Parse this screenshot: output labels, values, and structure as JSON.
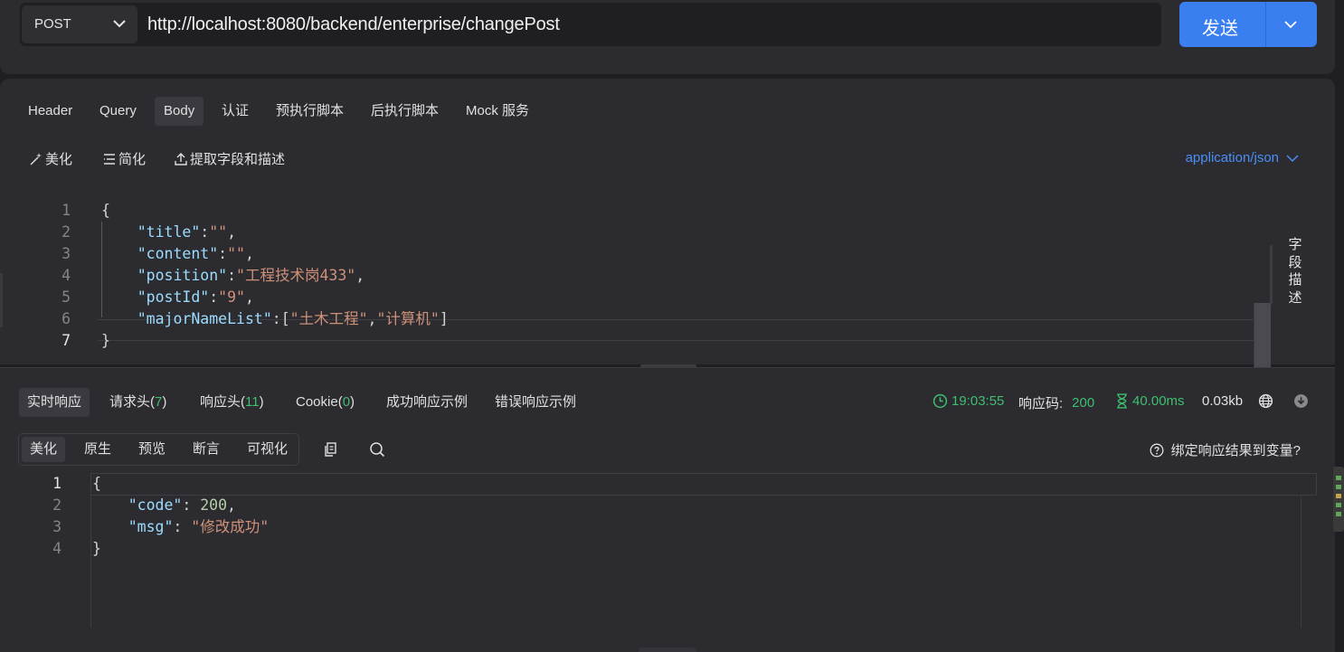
{
  "request": {
    "method": "POST",
    "url": "http://localhost:8080/backend/enterprise/changePost",
    "send_label": "发送"
  },
  "request_tabs": [
    "Header",
    "Query",
    "Body",
    "认证",
    "预执行脚本",
    "后执行脚本",
    "Mock 服务"
  ],
  "active_request_tab": "Body",
  "body_tools": {
    "beautify": "美化",
    "simplify": "简化",
    "extract": "提取字段和描述",
    "content_type": "application/json"
  },
  "request_body": {
    "line_numbers": [
      "1",
      "2",
      "3",
      "4",
      "5",
      "6",
      "7"
    ],
    "lines": [
      {
        "tokens": [
          {
            "t": "p",
            "v": "{"
          }
        ]
      },
      {
        "tokens": [
          {
            "t": "p",
            "v": "    "
          },
          {
            "t": "k",
            "v": "\"title\""
          },
          {
            "t": "p",
            "v": ":"
          },
          {
            "t": "s",
            "v": "\"\""
          },
          {
            "t": "p",
            "v": ","
          }
        ]
      },
      {
        "tokens": [
          {
            "t": "p",
            "v": "    "
          },
          {
            "t": "k",
            "v": "\"content\""
          },
          {
            "t": "p",
            "v": ":"
          },
          {
            "t": "s",
            "v": "\"\""
          },
          {
            "t": "p",
            "v": ","
          }
        ]
      },
      {
        "tokens": [
          {
            "t": "p",
            "v": "    "
          },
          {
            "t": "k",
            "v": "\"position\""
          },
          {
            "t": "p",
            "v": ":"
          },
          {
            "t": "s",
            "v": "\"工程技术岗433\""
          },
          {
            "t": "p",
            "v": ","
          }
        ]
      },
      {
        "tokens": [
          {
            "t": "p",
            "v": "    "
          },
          {
            "t": "k",
            "v": "\"postId\""
          },
          {
            "t": "p",
            "v": ":"
          },
          {
            "t": "s",
            "v": "\"9\""
          },
          {
            "t": "p",
            "v": ","
          }
        ]
      },
      {
        "tokens": [
          {
            "t": "p",
            "v": "    "
          },
          {
            "t": "k",
            "v": "\"majorNameList\""
          },
          {
            "t": "p",
            "v": ":["
          },
          {
            "t": "s",
            "v": "\"土木工程\""
          },
          {
            "t": "p",
            "v": ","
          },
          {
            "t": "s",
            "v": "\"计算机\""
          },
          {
            "t": "p",
            "v": "]"
          }
        ]
      },
      {
        "tokens": [
          {
            "t": "p",
            "v": "}"
          }
        ]
      }
    ]
  },
  "field_desc_label": "字段描述",
  "response_tabs": {
    "live": "实时响应",
    "req_headers": "请求头(",
    "req_headers_count": "7",
    "resp_headers": "响应头(",
    "resp_headers_count": "11",
    "cookie": "Cookie(",
    "cookie_count": "0",
    "close_paren": ")",
    "success_example": "成功响应示例",
    "error_example": "错误响应示例"
  },
  "response_meta": {
    "time": "19:03:55",
    "status_label": "响应码:",
    "status_code": "200",
    "duration": "40.00ms",
    "size": "0.03kb"
  },
  "response_view_tabs": [
    "美化",
    "原生",
    "预览",
    "断言",
    "可视化"
  ],
  "active_response_view": "美化",
  "bind_variable_label": "绑定响应结果到变量?",
  "response_body": {
    "line_numbers": [
      "1",
      "2",
      "3",
      "4"
    ],
    "lines": [
      {
        "tokens": [
          {
            "t": "p",
            "v": "{"
          }
        ]
      },
      {
        "tokens": [
          {
            "t": "p",
            "v": "    "
          },
          {
            "t": "k",
            "v": "\"code\""
          },
          {
            "t": "p",
            "v": ": "
          },
          {
            "t": "n",
            "v": "200"
          },
          {
            "t": "p",
            "v": ","
          }
        ]
      },
      {
        "tokens": [
          {
            "t": "p",
            "v": "    "
          },
          {
            "t": "k",
            "v": "\"msg\""
          },
          {
            "t": "p",
            "v": ": "
          },
          {
            "t": "s",
            "v": "\"修改成功\""
          }
        ]
      },
      {
        "tokens": [
          {
            "t": "p",
            "v": "}"
          }
        ]
      }
    ]
  },
  "colors": {
    "accent": "#3a7ff0",
    "link": "#4a8ff5",
    "success": "#3fbf6f",
    "json_key": "#9cdcfe",
    "json_string": "#ce9178",
    "json_number": "#b5cea8"
  }
}
